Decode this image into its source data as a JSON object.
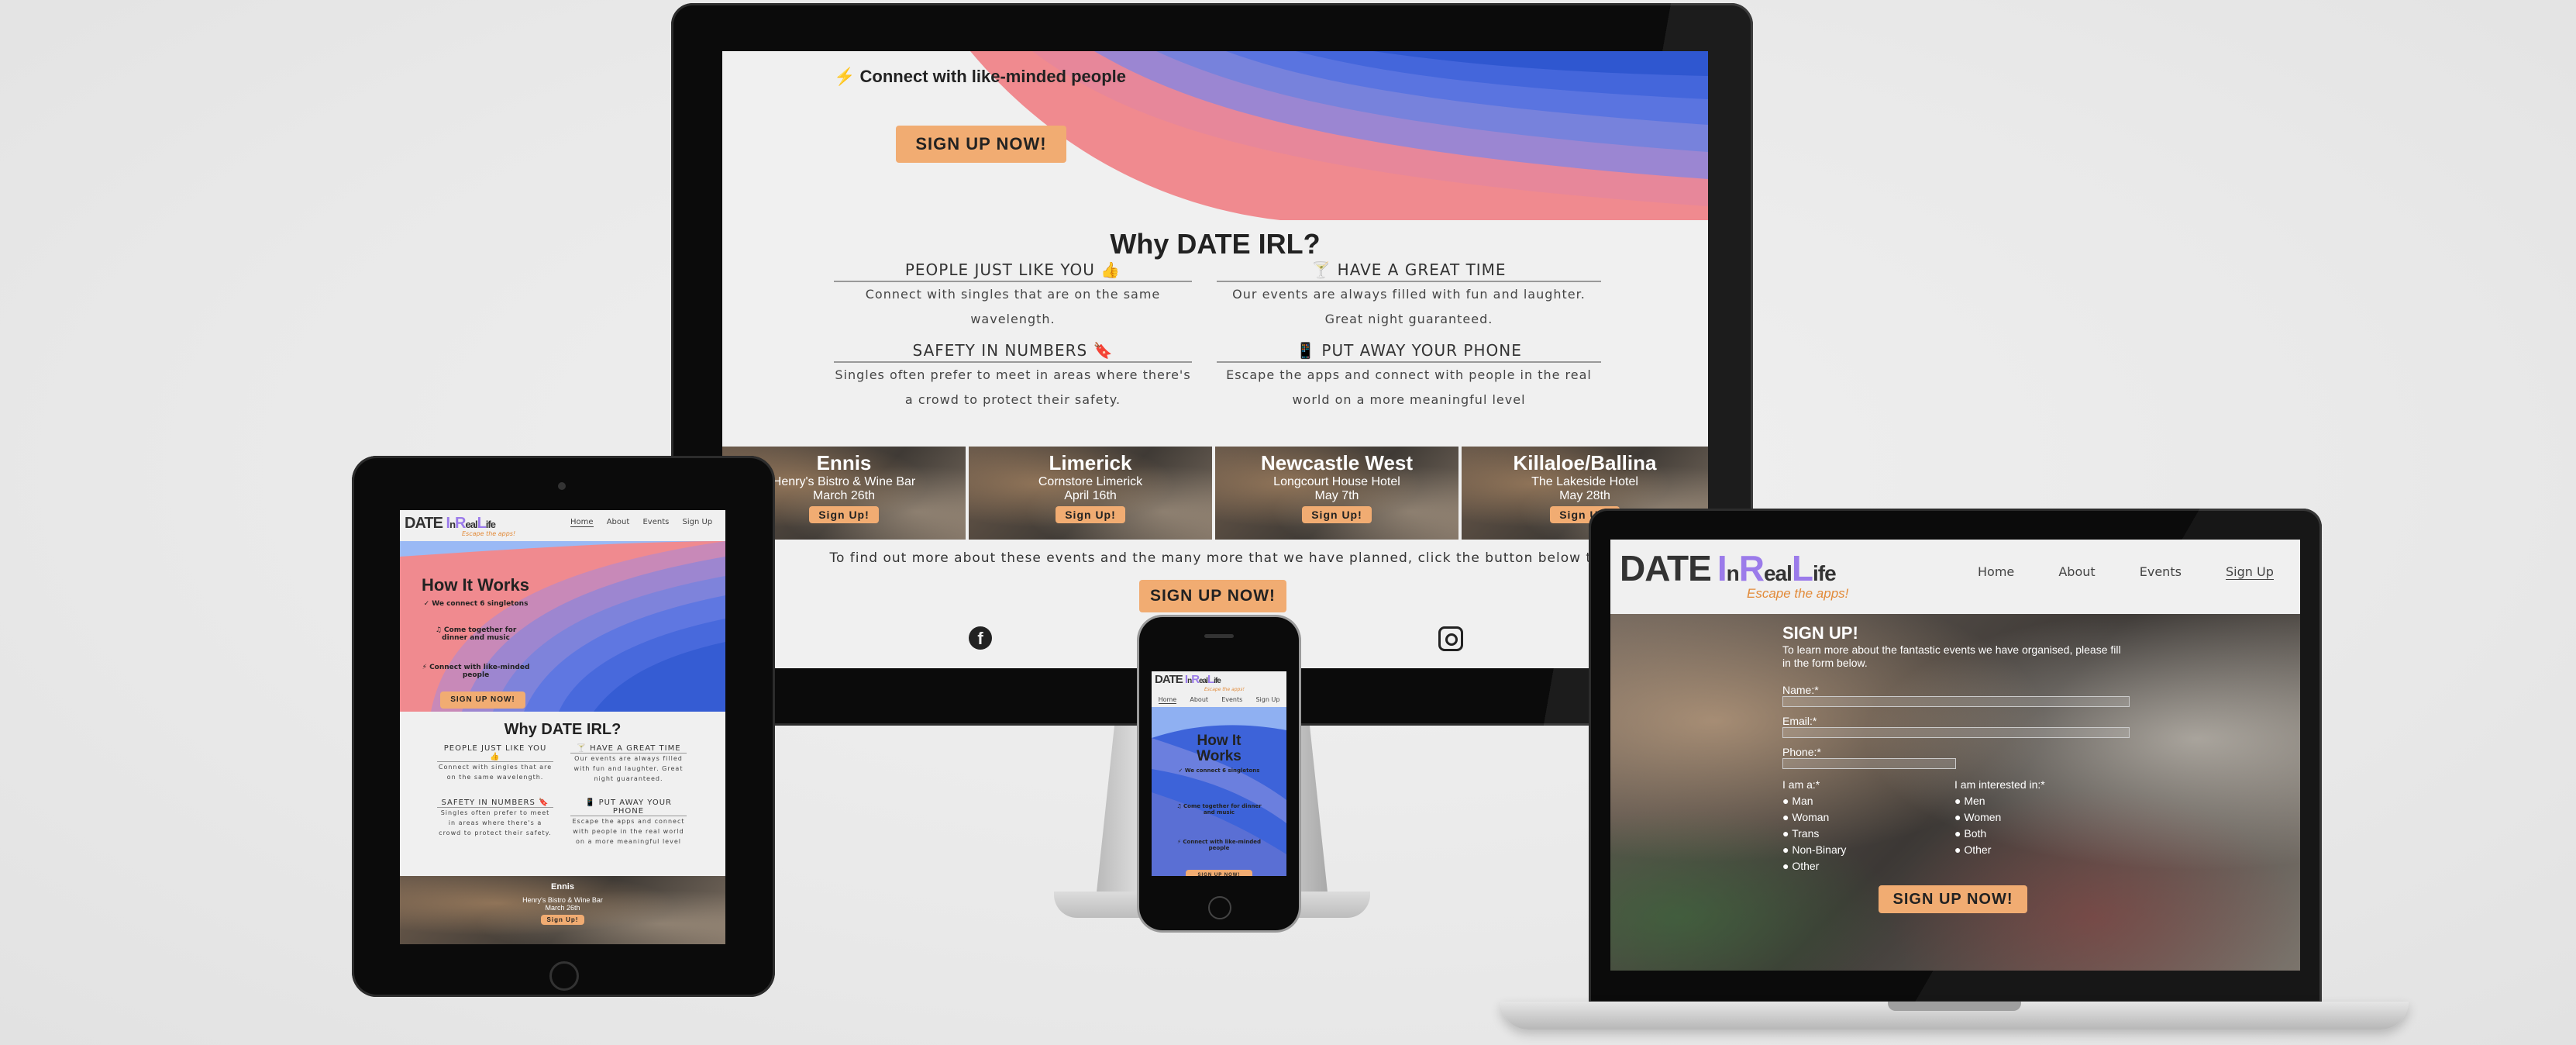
{
  "brand": {
    "word_date": "DATE",
    "word_in_i": "I",
    "word_in_n": "n",
    "word_real_r": "R",
    "word_real_rest": "eal",
    "word_life_l": "L",
    "word_life_rest": "ife",
    "tagline": "Escape the apps!"
  },
  "nav": {
    "home": "Home",
    "about": "About",
    "events": "Events",
    "signup": "Sign Up"
  },
  "hero": {
    "title": "How It Works",
    "step1": "We connect 6 singletons",
    "step2": "Come together for dinner and music",
    "step3": "Connect with like-minded people",
    "cta": "SIGN UP NOW!"
  },
  "why": {
    "title": "Why DATE IRL?",
    "features": [
      {
        "head": "PEOPLE JUST LIKE YOU",
        "text": "Connect with singles that are on the same wavelength."
      },
      {
        "head": "HAVE A GREAT TIME",
        "text": "Our events are always filled with fun and laughter. Great night guaranteed."
      },
      {
        "head": "SAFETY IN NUMBERS",
        "text": "Singles often prefer to meet in areas where there's a crowd to protect their safety."
      },
      {
        "head": "PUT AWAY YOUR PHONE",
        "text": "Escape the apps and connect with people in the real world on a more meaningful level"
      }
    ]
  },
  "events": [
    {
      "town": "Ennis",
      "venue": "Henry's Bistro & Wine Bar",
      "date": "March 26th",
      "btn": "Sign Up!"
    },
    {
      "town": "Limerick",
      "venue": "Cornstore Limerick",
      "date": "April 16th",
      "btn": "Sign Up!"
    },
    {
      "town": "Newcastle West",
      "venue": "Longcourt House Hotel",
      "date": "May 7th",
      "btn": "Sign Up!"
    },
    {
      "town": "Killaloe/Ballina",
      "venue": "The Lakeside Hotel",
      "date": "May 28th",
      "btn": "Sign Up!"
    }
  ],
  "events_footer": {
    "text": "To find out more about these events and the many more that we have planned, click the button below to",
    "cta": "SIGN UP NOW!"
  },
  "signup_form": {
    "title": "SIGN UP!",
    "intro": "To learn more about the fantastic events we have organised, please fill in the form below.",
    "name_label": "Name:*",
    "email_label": "Email:*",
    "phone_label": "Phone:*",
    "iam_label": "I am a:*",
    "iam_options": [
      "Man",
      "Woman",
      "Trans",
      "Non-Binary",
      "Other"
    ],
    "interest_label": "I am interested in:*",
    "interest_options": [
      "Men",
      "Women",
      "Both",
      "Other"
    ],
    "submit": "SIGN UP NOW!"
  },
  "colors": {
    "accent": "#f1ac72",
    "brand_purple": "#9b7bea",
    "wave_blue": "#3d63d9",
    "wave_pink": "#f08a8f"
  },
  "icons": [
    "bolt-icon",
    "thumbs-up-icon",
    "cocktail-icon",
    "bookmark-icon",
    "mobile-phone-icon",
    "facebook-icon",
    "instagram-icon",
    "check-icon",
    "music-icon"
  ]
}
